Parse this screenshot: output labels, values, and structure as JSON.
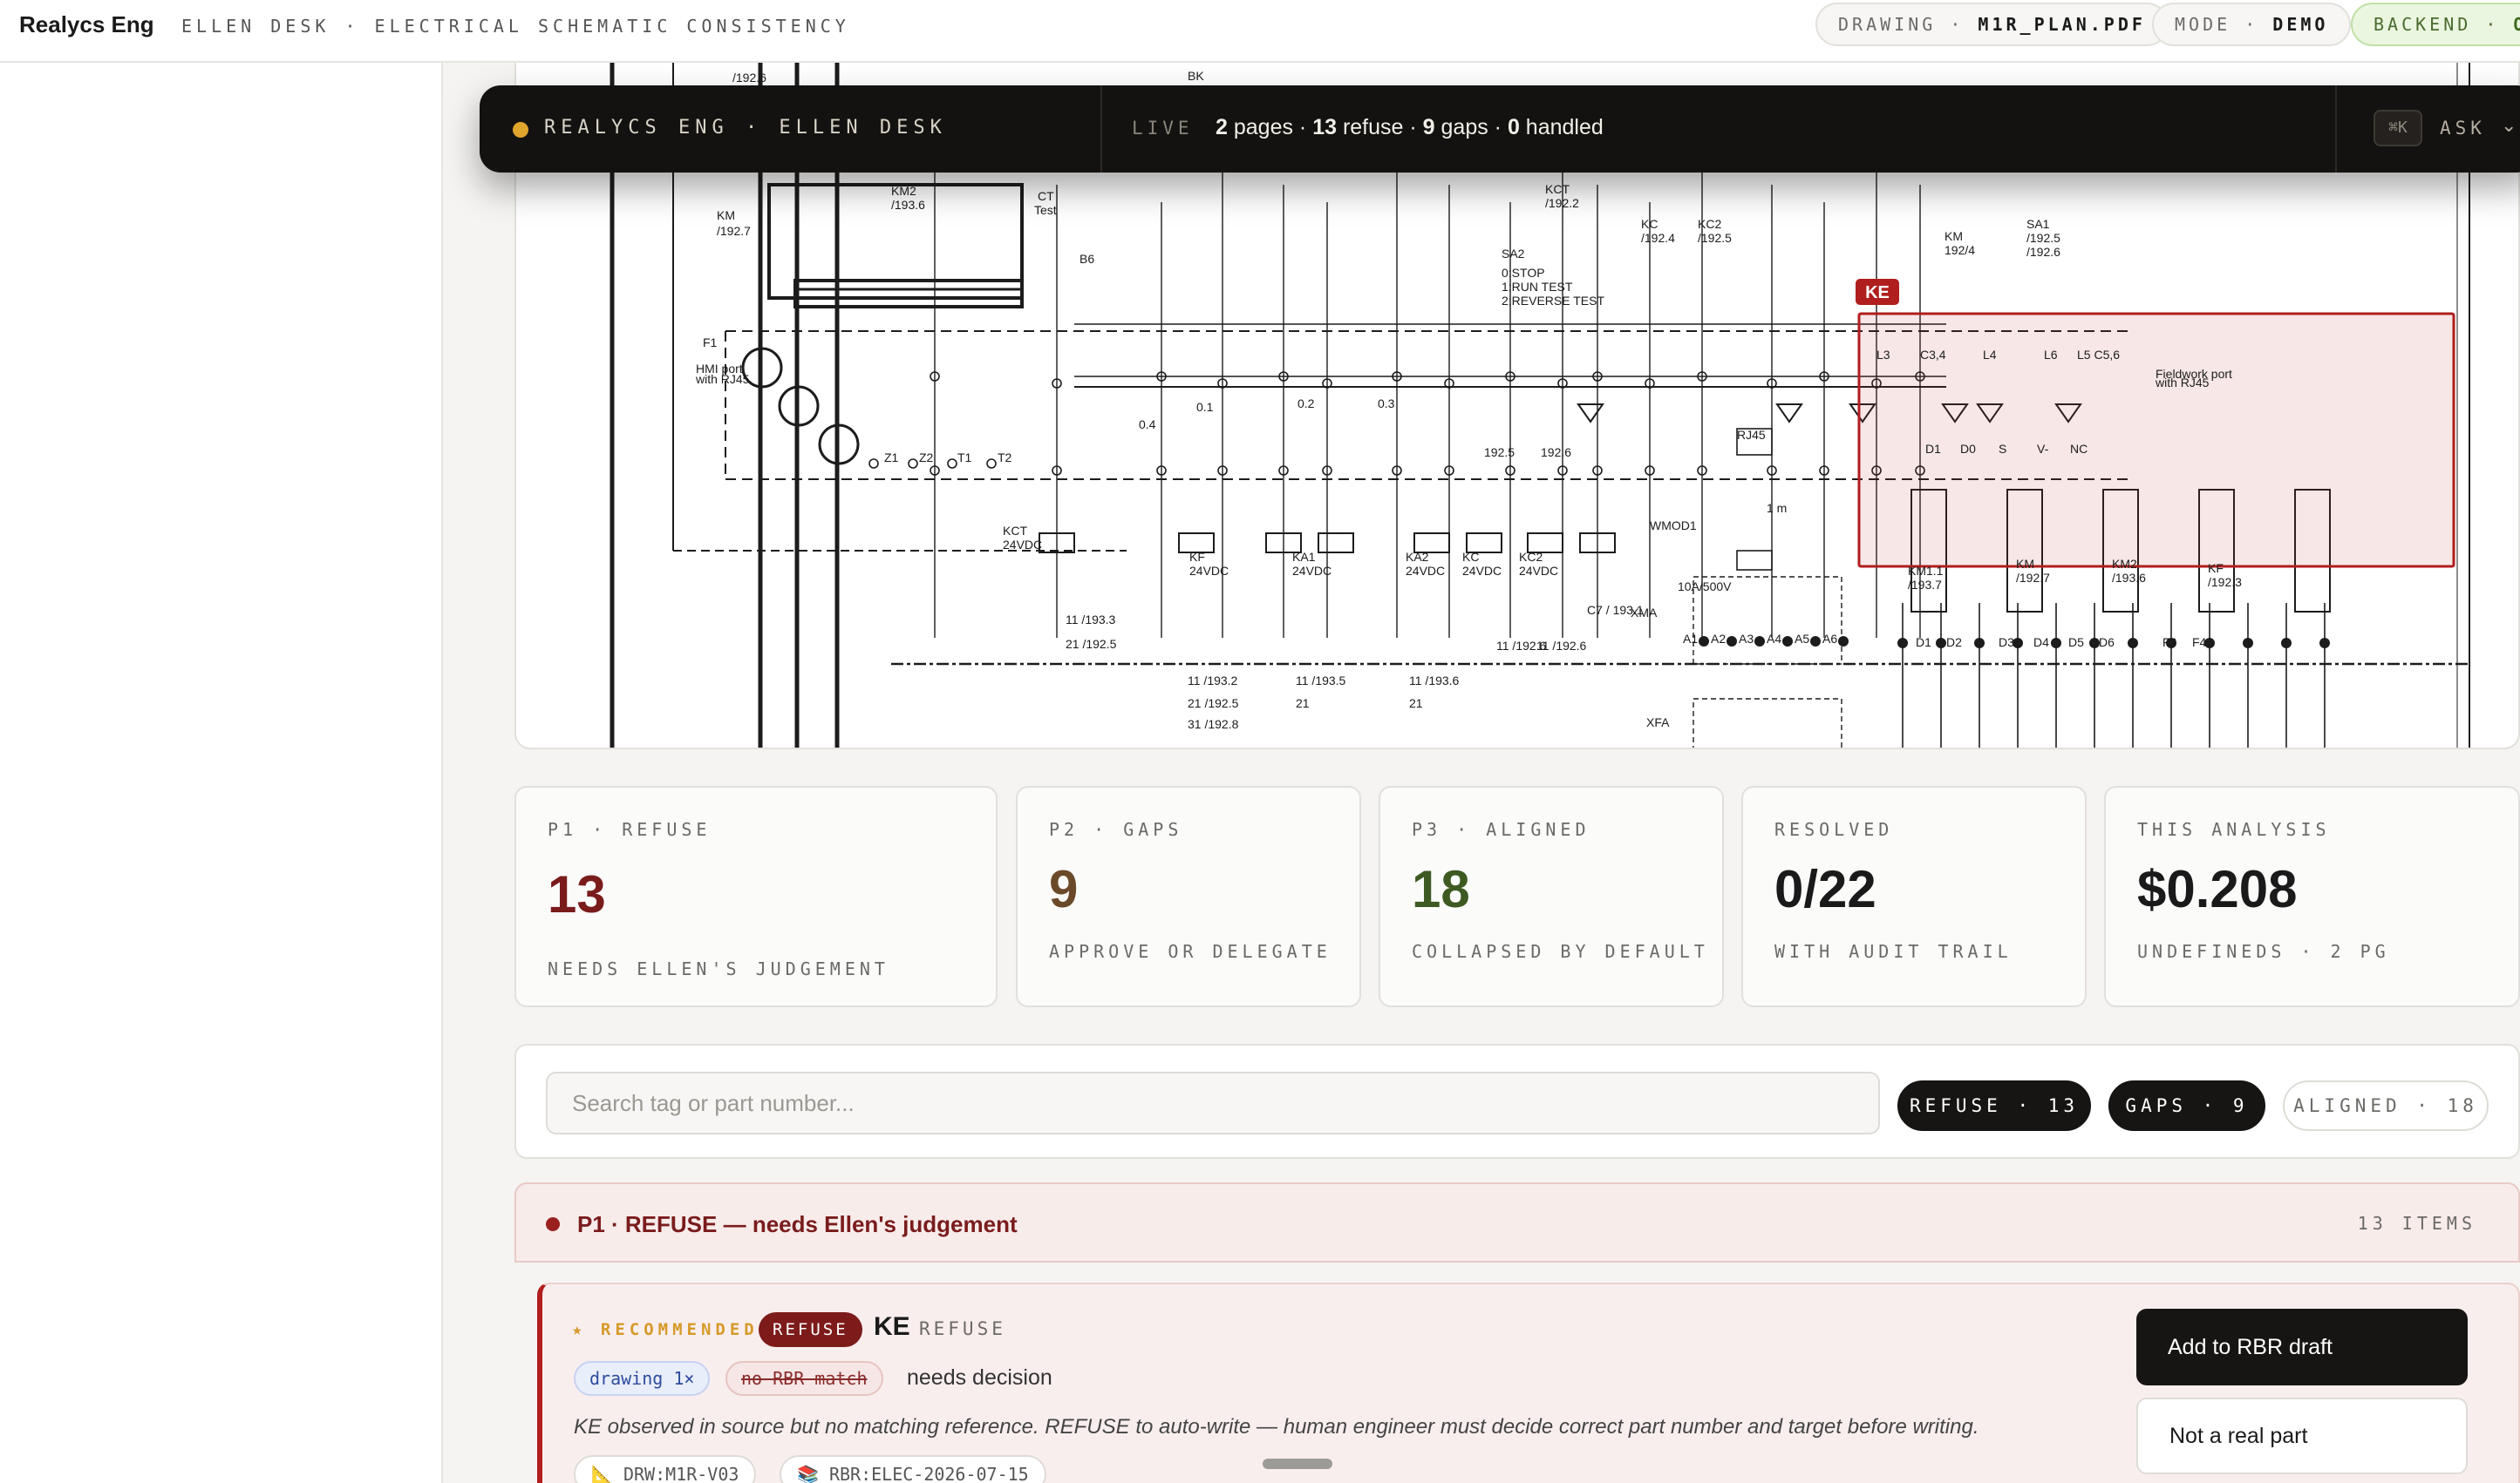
{
  "header": {
    "brand": "Realycs Eng",
    "breadcrumb": "ELLEN DESK · ELECTRICAL SCHEMATIC CONSISTENCY",
    "drawing_label": "DRAWING · ",
    "drawing_value": "M1R_PLAN.PDF",
    "mode_label": "MODE · ",
    "mode_value": "DEMO",
    "backend_label": "BACKEND · ",
    "backend_value": "OK"
  },
  "command_bar": {
    "title": "REALYCS ENG · ELLEN DESK",
    "live": "LIVE",
    "pages": "2",
    "pages_text": " pages · ",
    "refuse": "13",
    "refuse_text": " refuse · ",
    "gaps": "9",
    "gaps_text": " gaps · ",
    "handled": "0",
    "handled_text": " handled",
    "shortcut": "⌘K",
    "ask": "ASK",
    "chevron": "⌄"
  },
  "schematic": {
    "highlight_tag": "KE",
    "labels": [
      "KM",
      "/192.7",
      "KM2",
      "/193.6",
      "CT",
      "Test",
      "KCT",
      "/192.2",
      "KC",
      "/192.4",
      "KC2",
      "/192.5",
      "SA1",
      "/192.5",
      "/192.6",
      "KM",
      "192/4",
      "SA2",
      "0:STOP",
      "1:RUN TEST",
      "2:REVERSE TEST",
      "F1",
      "HMI port",
      "with RJ45",
      "KCT",
      "24VDC",
      "KF",
      "24VDC",
      "KA1",
      "24VDC",
      "KA2",
      "24VDC",
      "KC",
      "24VDC",
      "KC2",
      "24VDC",
      "C7 / 193.1",
      "XMA",
      "XFA",
      "WMOD1",
      "RJ45",
      "10A/500V",
      "KM1.1",
      "/193.7",
      "KM",
      "/192.7",
      "KM2",
      "/193.6",
      "KF",
      "/192.3",
      "Fieldwork port",
      "with RJ45",
      "B6",
      "Z1",
      "Z2",
      "T1",
      "T2",
      "A1",
      "A2",
      "A3",
      "A4",
      "A5",
      "A6",
      "D1",
      "D2",
      "D3",
      "D4",
      "D5",
      "D6",
      "F3",
      "F4",
      "1 m",
      "0.4",
      "0.1",
      "0.2",
      "0.3",
      "192.5",
      "192.6",
      "11 /193.3",
      "21 /192.5",
      "11 /193.2",
      "21 /192.5",
      "31 /192.8",
      "11 /193.5",
      "21",
      "11 /193.6",
      "21",
      "11 /192.6",
      "11 /192.6",
      "/192.6",
      "L3",
      "C3,4",
      "L4",
      "L6",
      "L5 C5,6",
      "D1",
      "D0",
      "S",
      "V-",
      "NC",
      "BK"
    ]
  },
  "stats": [
    {
      "label": "P1 · REFUSE",
      "value": "13",
      "sub": "NEEDS ELLEN'S JUDGEMENT",
      "color": "#7a1c1c"
    },
    {
      "label": "P2 · GAPS",
      "value": "9",
      "sub": "APPROVE OR DELEGATE",
      "color": "#6b4a2a"
    },
    {
      "label": "P3 · ALIGNED",
      "value": "18",
      "sub": "COLLAPSED BY DEFAULT",
      "color": "#3d5a22"
    },
    {
      "label": "RESOLVED",
      "value": "0/22",
      "sub": "WITH AUDIT TRAIL",
      "color": "#1a1a1a"
    },
    {
      "label": "THIS ANALYSIS",
      "value": "$0.208",
      "sub": "UNDEFINEDS · 2 PG",
      "color": "#1a1a1a"
    }
  ],
  "filters": {
    "search_placeholder": "Search tag or part number...",
    "chips": [
      {
        "label": "REFUSE · 13",
        "style": "dark"
      },
      {
        "label": "GAPS · 9",
        "style": "dark"
      },
      {
        "label": "ALIGNED · 18",
        "style": "light"
      }
    ]
  },
  "group": {
    "title": "P1 · REFUSE — needs Ellen's judgement",
    "count": "13 ITEMS"
  },
  "issue": {
    "recommended": "★ RECOMMENDED",
    "badge": "REFUSE",
    "tag": "KE",
    "status": "REFUSE",
    "source_chip": "drawing 1×",
    "match_chip": "no RBR match",
    "needs": "needs decision",
    "description": "KE observed in source but no matching reference. REFUSE to auto-write — human engineer must decide correct part number and target before writing.",
    "refs": [
      "📐 DRW:M1R-V03",
      "📚 RBR:ELEC-2026-07-15"
    ],
    "primary_action": "Add to RBR draft",
    "secondary_action": "Not a real part"
  }
}
